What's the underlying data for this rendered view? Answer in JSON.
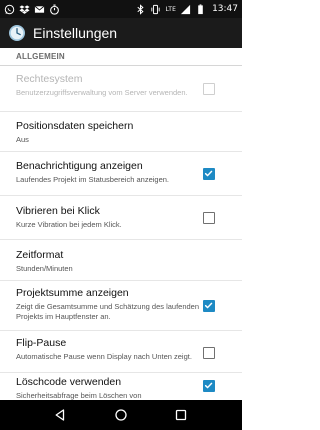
{
  "status_bar": {
    "network_label": "LTE",
    "time": "13:47",
    "left_icons": [
      "whatsapp-icon",
      "dropbox-icon",
      "mail-icon",
      "timer-icon"
    ],
    "right_icons": [
      "bluetooth-icon",
      "vibrate-icon",
      "signal-icon",
      "battery-icon"
    ]
  },
  "app_bar": {
    "title": "Einstellungen",
    "icon": "clock-app-icon"
  },
  "sections": [
    {
      "header": "ALLGEMEIN",
      "items": [
        {
          "title": "Rechtesystem",
          "summary": "Benutzerzugriffsverwaltung vom Server verwenden.",
          "control": "checkbox",
          "checked": false,
          "enabled": false
        },
        {
          "title": "Positionsdaten speichern",
          "summary": "Aus",
          "control": "none",
          "enabled": true
        },
        {
          "title": "Benachrichtigung anzeigen",
          "summary": "Laufendes Projekt im Statusbereich anzeigen.",
          "control": "checkbox",
          "checked": true,
          "enabled": true
        },
        {
          "title": "Vibrieren bei Klick",
          "summary": "Kurze Vibration bei jedem Klick.",
          "control": "checkbox",
          "checked": false,
          "enabled": true
        },
        {
          "title": "Zeitformat",
          "summary": "Stunden/Minuten",
          "control": "none",
          "enabled": true
        },
        {
          "title": "Projektsumme anzeigen",
          "summary": "Zeigt die Gesamtsumme und Schätzung des laufenden Projekts im Hauptfenster an.",
          "control": "checkbox",
          "checked": true,
          "enabled": true
        },
        {
          "title": "Flip-Pause",
          "summary": "Automatische Pause wenn Display nach Unten zeigt.",
          "control": "checkbox",
          "checked": false,
          "enabled": true
        },
        {
          "title": "Löschcode verwenden",
          "summary": "Sicherheitsabfrage beim Löschen von",
          "control": "checkbox",
          "checked": true,
          "enabled": true
        }
      ]
    }
  ],
  "colors": {
    "accent": "#1e8ac4",
    "app_bar": "#1b1b1b",
    "status_bar": "#111111"
  },
  "nav_bar": {
    "buttons": [
      "back-icon",
      "home-icon",
      "recents-icon"
    ]
  }
}
